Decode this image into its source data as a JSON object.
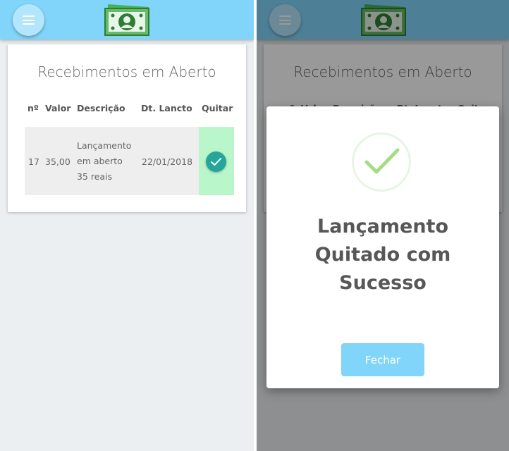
{
  "screens": {
    "left": {
      "card_title": "Recebimentos em Aberto",
      "columns": [
        "nº",
        "Valor",
        "Descrição",
        "Dt. Lancto",
        "Quitar"
      ],
      "row": {
        "numero": "17",
        "valor": "35,00",
        "descricao_lines": [
          "Lançamento",
          "em aberto",
          "35 reais"
        ],
        "data": "22/01/2018"
      }
    },
    "right": {
      "card_title": "Recebimentos em Aberto",
      "columns": [
        "nº",
        "Valor",
        "Descrição",
        "Dt. Lancto",
        "Quitar"
      ],
      "dialog": {
        "title_lines": [
          "Lançamento",
          "Quitado com",
          "Sucesso"
        ],
        "button": "Fechar"
      }
    }
  },
  "icons": {
    "menu": "hamburger-menu-icon",
    "logo": "banknote-logo-icon",
    "quitar": "checkmark-icon",
    "success": "success-check-icon"
  },
  "colors": {
    "topbar": "#81d4fa",
    "accent_teal": "#26a69a",
    "quitar_cell": "#b9f6ca",
    "success_green": "#a5dc86"
  }
}
